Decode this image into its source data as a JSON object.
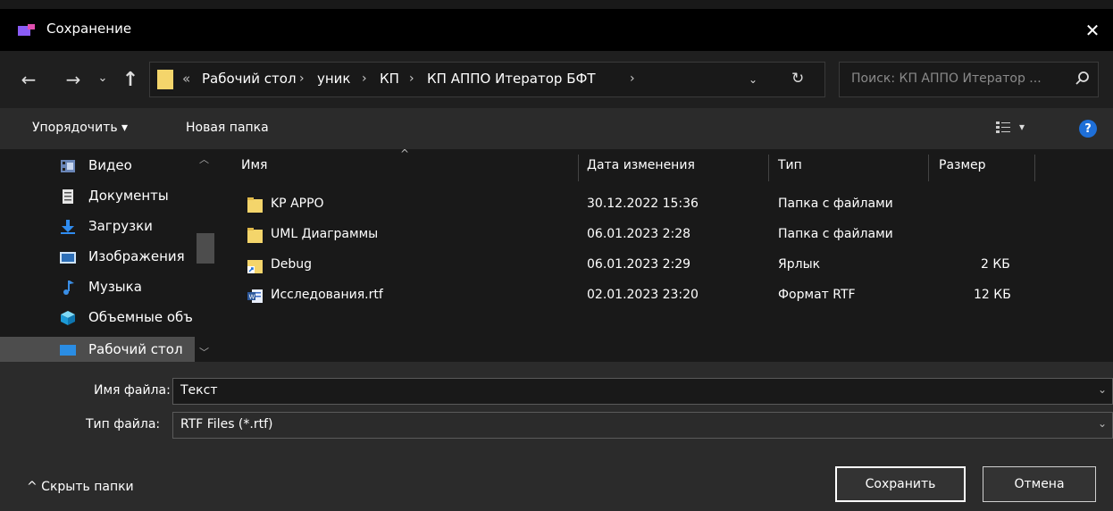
{
  "window": {
    "title": "Сохранение",
    "close": "✕"
  },
  "nav": {
    "back": "←",
    "forward": "→",
    "recent": "⌄",
    "up": "↑",
    "breadcrumb_prefix": "«",
    "breadcrumb": [
      "Рабочий стол",
      "уник",
      "КП",
      "КП АППО Итератор БФТ"
    ],
    "sep": "›",
    "dropdown": "⌄",
    "refresh": "↻",
    "search_placeholder": "Поиск: КП АППО Итератор ..."
  },
  "toolbar": {
    "organize": "Упорядочить ▾",
    "new_folder": "Новая папка",
    "view_caret": "▾",
    "help": "?"
  },
  "sidebar": {
    "items": [
      {
        "label": "Видео",
        "icon": "video-icon"
      },
      {
        "label": "Документы",
        "icon": "documents-icon"
      },
      {
        "label": "Загрузки",
        "icon": "downloads-icon"
      },
      {
        "label": "Изображения",
        "icon": "pictures-icon"
      },
      {
        "label": "Музыка",
        "icon": "music-icon"
      },
      {
        "label": "Объемные объекты",
        "icon": "3d-objects-icon"
      },
      {
        "label": "Рабочий стол",
        "icon": "desktop-icon"
      }
    ],
    "selected": 6
  },
  "filelist": {
    "columns": [
      "Имя",
      "Дата изменения",
      "Тип",
      "Размер"
    ],
    "sort_arrow": "^",
    "rows": [
      {
        "name": "KP APPO",
        "date": "30.12.2022 15:36",
        "type": "Папка с файлами",
        "size": "",
        "icon": "folder-icon"
      },
      {
        "name": "UML Диаграммы",
        "date": "06.01.2023 2:28",
        "type": "Папка с файлами",
        "size": "",
        "icon": "folder-icon"
      },
      {
        "name": "Debug",
        "date": "06.01.2023 2:29",
        "type": "Ярлык",
        "size": "2 КБ",
        "icon": "shortcut-icon"
      },
      {
        "name": "Исследования.rtf",
        "date": "02.01.2023 23:20",
        "type": "Формат RTF",
        "size": "12 КБ",
        "icon": "word-document-icon"
      }
    ]
  },
  "form": {
    "filename_label": "Имя файла:",
    "filename_value": "Текст",
    "filetype_label": "Тип файла:",
    "filetype_value": "RTF Files (*.rtf)",
    "caret": "⌄"
  },
  "footer": {
    "hide_folders": "^  Скрыть папки",
    "save": "Сохранить",
    "cancel": "Отмена"
  },
  "colors": {
    "background": "#191919",
    "toolbar": "#2b2b2b",
    "folder": "#f4d56b",
    "help": "#1e6fd8",
    "selection": "#4d4d4d"
  }
}
